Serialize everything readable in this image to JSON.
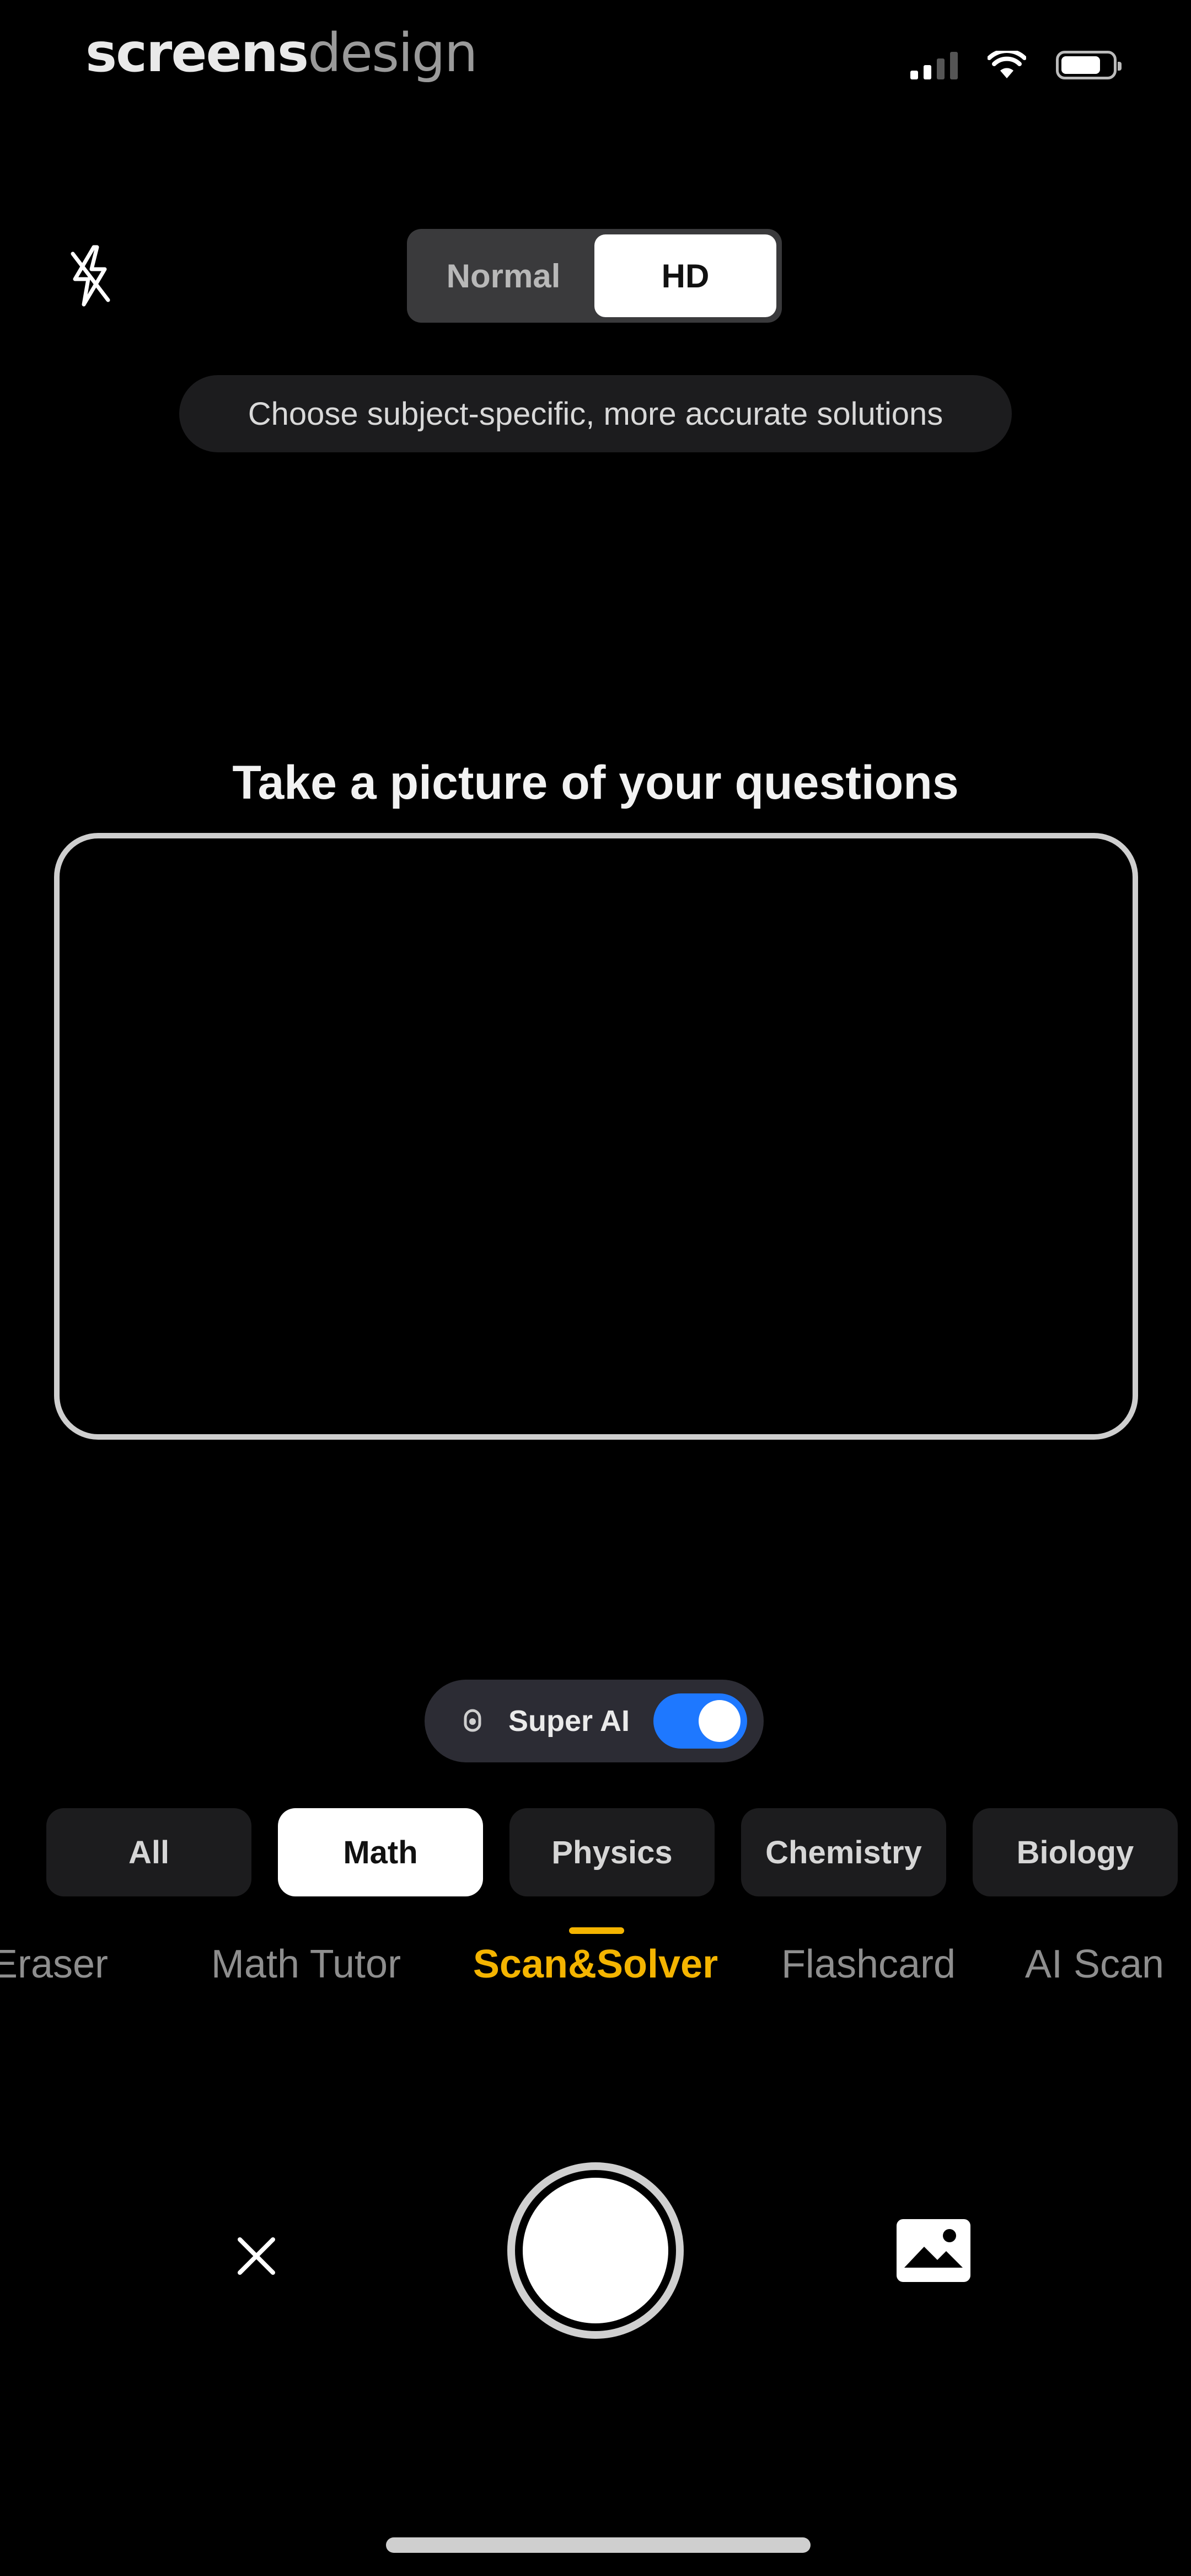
{
  "status_bar": {
    "watermark_bold": "screens",
    "watermark_light": "design"
  },
  "quality_toggle": {
    "options": [
      "Normal",
      "HD"
    ],
    "selected": "HD"
  },
  "hint_text": "Choose subject-specific, more accurate solutions",
  "title": "Take a picture of your questions",
  "super_ai": {
    "label": "Super AI",
    "enabled": true
  },
  "subjects": {
    "items": [
      "All",
      "Math",
      "Physics",
      "Chemistry",
      "Biology"
    ],
    "selected": "Math"
  },
  "modes": {
    "items": [
      "t Eraser",
      "Math Tutor",
      "Scan&Solver",
      "Flashcard",
      "AI Scan"
    ],
    "selected": "Scan&Solver"
  },
  "colors": {
    "accent": "#f4b400",
    "toggle_on": "#1e78ff",
    "background": "#000000"
  },
  "icons": {
    "flash": "flash-off-icon",
    "close": "close-icon",
    "shutter": "shutter-button",
    "gallery": "gallery-icon",
    "super_ai": "ai-sparkle-icon"
  }
}
